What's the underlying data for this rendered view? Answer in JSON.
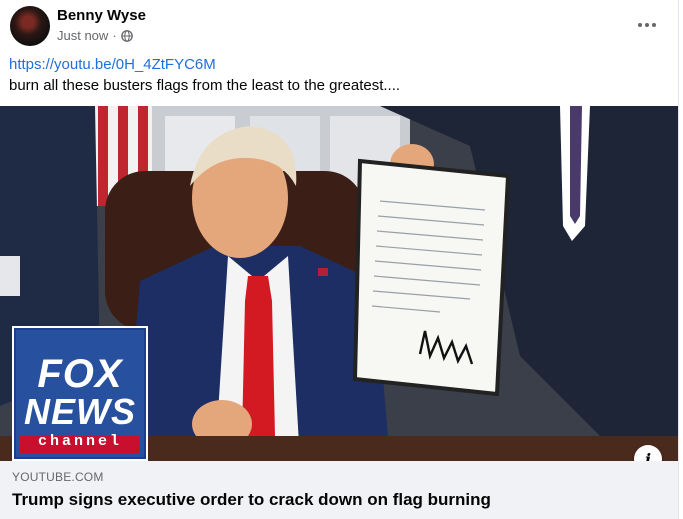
{
  "post": {
    "author": "Benny Wyse",
    "timestamp": "Just now",
    "separator": "·",
    "privacy_icon": "globe-icon",
    "more_icon": "more-horizontal-icon",
    "link_text": "https://youtu.be/0H_4ZtFYC6M",
    "caption": "burn all these busters flags from the least to the greatest...."
  },
  "media": {
    "watermark_logo": [
      "FOX",
      "NEWS",
      "channel"
    ],
    "info_icon": "info-icon",
    "info_label": "i"
  },
  "link_preview": {
    "domain": "YOUTUBE.COM",
    "headline": "Trump signs executive order to crack down on flag burning"
  },
  "colors": {
    "link": "#216fdb",
    "text_primary": "#050505",
    "text_secondary": "#65676b",
    "preview_bg": "#f0f2f5",
    "fox_blue": "#1b3f8e",
    "fox_red": "#c8102e"
  }
}
